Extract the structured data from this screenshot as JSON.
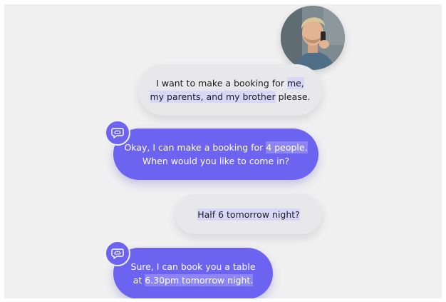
{
  "colors": {
    "background": "#f0f0f1",
    "bot_bubble": "#6c63f0",
    "user_bubble": "#e8e8ea",
    "highlight_user": "#d9d6f8"
  },
  "user_avatar": {
    "icon": "user-avatar-photo"
  },
  "messages": [
    {
      "sender": "user",
      "line1_pre": "I want to make a booking for ",
      "line1_hl": "me,",
      "line2_hl": "my parents, and my brother",
      "line2_post": " please."
    },
    {
      "sender": "bot",
      "icon": "speech-bubble-brain-icon",
      "line1_pre": "Okay, I can make a booking for ",
      "line1_hl": "4 people.",
      "line2": "When would you like to come in?"
    },
    {
      "sender": "user",
      "line1_hl": "Half 6 tomorrow night?"
    },
    {
      "sender": "bot",
      "icon": "speech-bubble-brain-icon",
      "line1": "Sure, I can book you a table",
      "line2_pre": "at ",
      "line2_hl": "6.30pm tomorrow night."
    }
  ]
}
